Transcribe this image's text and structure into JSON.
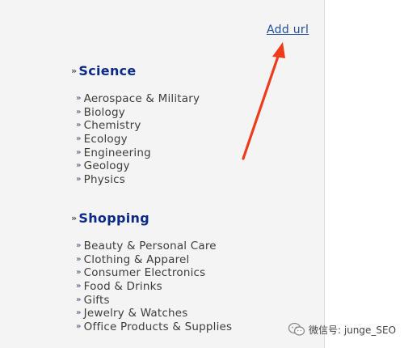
{
  "add_url_link": "Add url",
  "bullet_glyph": "»",
  "sections": [
    {
      "title": "Science",
      "items": [
        "Aerospace & Military",
        "Biology",
        "Chemistry",
        "Ecology",
        "Engineering",
        "Geology",
        "Physics"
      ]
    },
    {
      "title": "Shopping",
      "items": [
        "Beauty & Personal Care",
        "Clothing & Apparel",
        "Consumer Electronics",
        "Food & Drinks",
        "Gifts",
        "Jewelry & Watches",
        "Office Products & Supplies"
      ]
    }
  ],
  "watermark": {
    "text": "微信号: junge_SEO",
    "icon": "wechat-logo-icon"
  },
  "colors": {
    "link": "#1f4e9a",
    "section_title": "#0b2a85",
    "arrow": "#ee3b1c",
    "panel_bg": "#f4f4f4"
  }
}
